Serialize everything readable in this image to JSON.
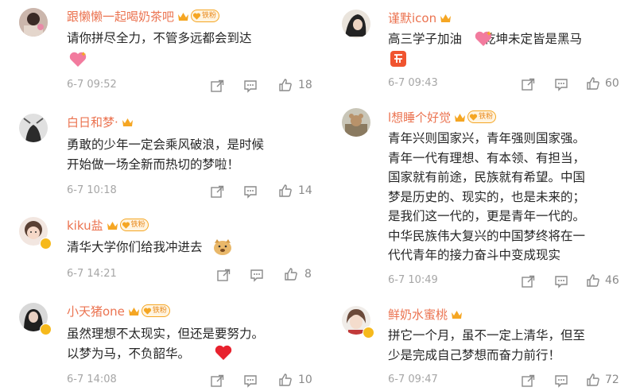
{
  "badge_label": "铁粉",
  "comments": [
    {
      "user": "跟懒懒一起喝奶茶吧",
      "text": [
        "请你拼尽全力，不管多远都会到达"
      ],
      "time": "6-7 09:52",
      "likes": "18"
    },
    {
      "user": "白日和梦·",
      "text": [
        "勇敢的少年一定会乘风破浪，是时候",
        "开始做一场全新而热切的梦啦！"
      ],
      "time": "6-7 10:18",
      "likes": "14"
    },
    {
      "user": "kiku盐",
      "text": [
        "清华大学你们给我冲进去"
      ],
      "time": "6-7 14:21",
      "likes": "8"
    },
    {
      "user": "小天猪one",
      "text": [
        "虽然理想不太现实，但还是要努力。",
        "以梦为马，不负韶华。"
      ],
      "time": "6-7 14:08",
      "likes": "10"
    },
    {
      "user": "谨默icon",
      "text": [
        "高三学子加油",
        "乾坤未定皆是黑马"
      ],
      "time": "6-7 09:43",
      "likes": "60"
    },
    {
      "user": "l想睡个好觉",
      "text": [
        "青年兴则国家兴，青年强则国家强。",
        "青年一代有理想、有本领、有担当，",
        "国家就有前途，民族就有希望。中国",
        "梦是历史的、现实的，也是未来的；",
        "是我们这一代的，更是青年一代的。",
        "中华民族伟大复兴的中国梦终将在一",
        "代代青年的接力奋斗中变成现实"
      ],
      "time": "6-7 10:49",
      "likes": "46"
    },
    {
      "user": "鲜奶水蜜桃",
      "text": [
        "拼它一个月，虽不一定上清华，但至",
        "少是完成自己梦想而奋力前行！"
      ],
      "time": "6-7 09:47",
      "likes": "72"
    }
  ],
  "colors": {
    "username": "#eb7350",
    "text": "#262626",
    "time": "#a6a6a6",
    "icon": "#8a8a8a",
    "badge": "#f5a623"
  }
}
